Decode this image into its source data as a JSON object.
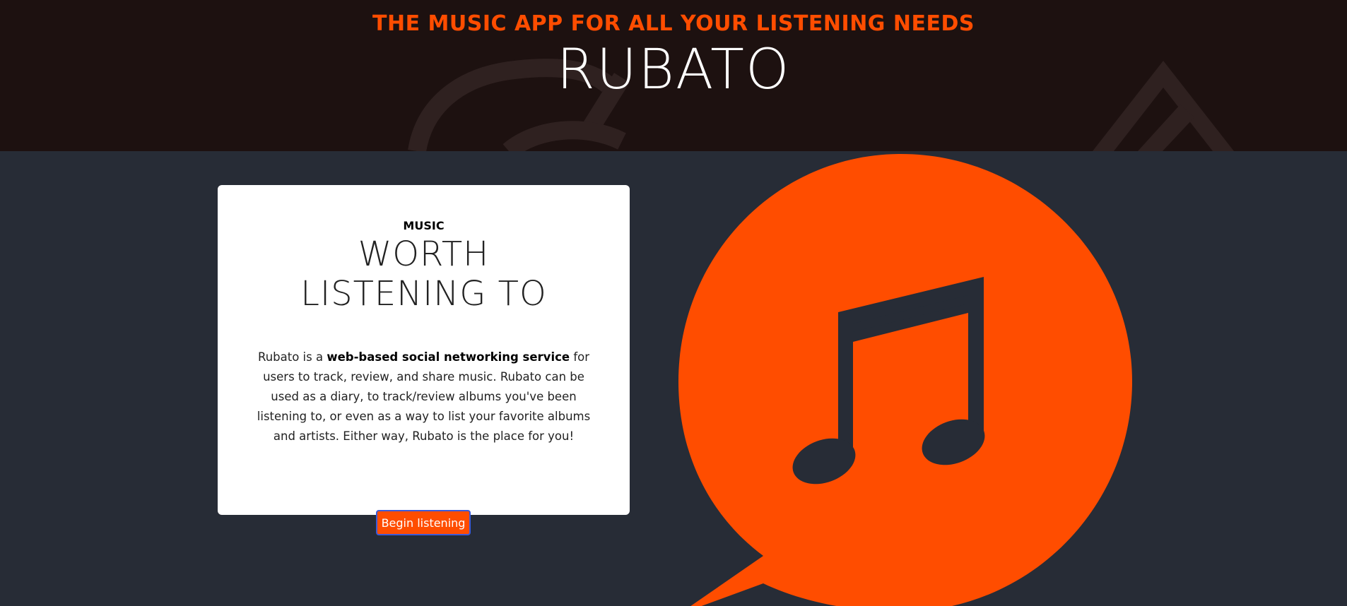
{
  "header": {
    "tagline": "THE MUSIC APP FOR ALL YOUR LISTENING NEEDS",
    "brand": "RUBATO"
  },
  "card": {
    "kicker": "MUSIC",
    "title": "WORTH LISTENING TO",
    "body_prefix": "Rubato is a ",
    "body_bold": "web-based social networking service",
    "body_suffix": " for users to track, review, and share music. Rubato can be used as a diary, to track/review albums you've been listening to, or even as a way to list your favorite albums and artists. Either way, Rubato is the place for you!"
  },
  "cta": {
    "label": "Begin listening"
  },
  "colors": {
    "accent": "#ff4d00",
    "header_bg": "#1d1110",
    "main_bg": "#272c36"
  },
  "icons": [
    "treble-clef-decor-icon",
    "triangle-decor-icon",
    "music-note-speech-bubble-icon"
  ]
}
